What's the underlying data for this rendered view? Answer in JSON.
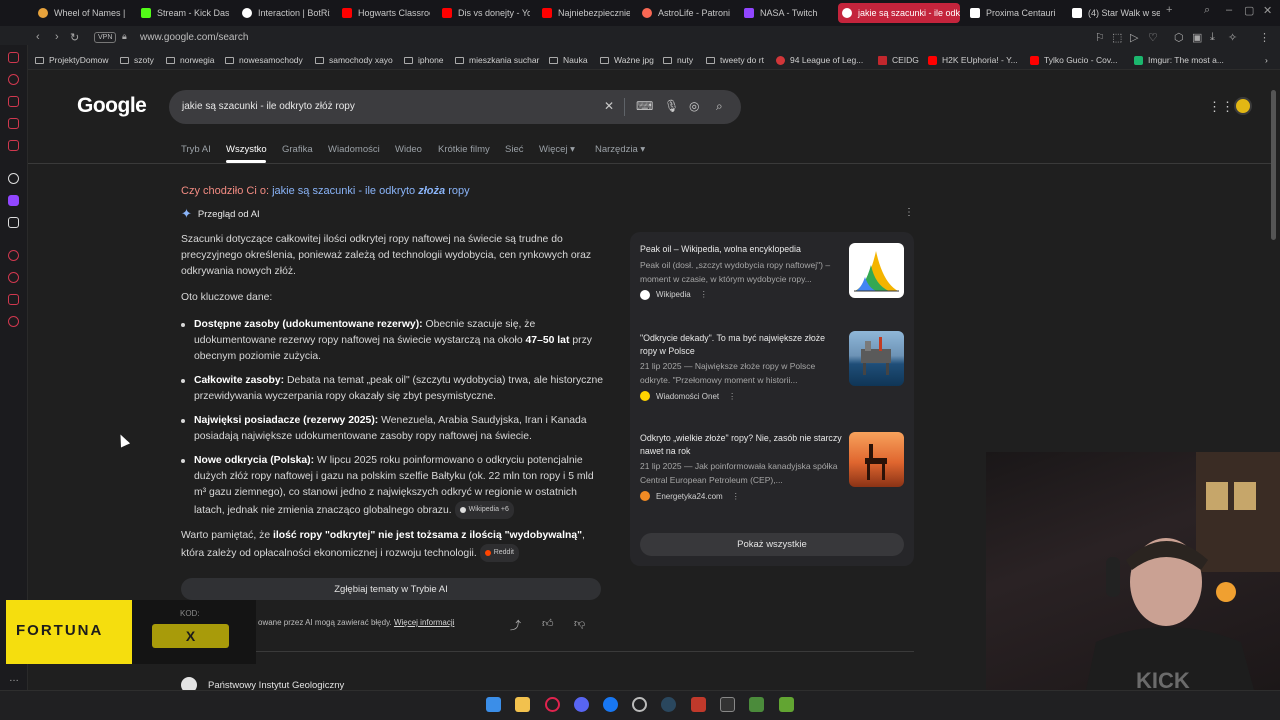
{
  "browser": {
    "tabs": [
      {
        "label": "Wheel of Names | F",
        "color": "#e8a33c"
      },
      {
        "label": "Stream - Kick Dash",
        "color": "#53fc18"
      },
      {
        "label": "Interaction | BotRix",
        "color": "#ffffff"
      },
      {
        "label": "Hogwarts Classroo",
        "color": "#ff0000"
      },
      {
        "label": "Dis vs donejty - Yo",
        "color": "#ff0000"
      },
      {
        "label": "Najniebezpieczniej",
        "color": "#ff0000"
      },
      {
        "label": "AstroLife - Patroni",
        "color": "#f96854"
      },
      {
        "label": "NASA - Twitch",
        "color": "#9146ff"
      },
      {
        "label": "jakie są szacunki - ile odk",
        "color": "#ffffff"
      },
      {
        "label": "Proxima Centauri b",
        "color": "#ffffff"
      },
      {
        "label": "(4) Star Walk w ser",
        "color": "#ffffff"
      }
    ],
    "vpn_label": "VPN",
    "url": "www.google.com/search",
    "bookmarks": [
      {
        "label": "ProjektyDomow",
        "type": "folder"
      },
      {
        "label": "szoty",
        "type": "folder"
      },
      {
        "label": "norwegia",
        "type": "folder"
      },
      {
        "label": "nowesamochody",
        "type": "folder"
      },
      {
        "label": "samochody xayo",
        "type": "folder"
      },
      {
        "label": "iphone",
        "type": "folder"
      },
      {
        "label": "mieszkania suchar",
        "type": "folder"
      },
      {
        "label": "Nauka",
        "type": "folder"
      },
      {
        "label": "Ważne jpg",
        "type": "folder"
      },
      {
        "label": "nuty",
        "type": "folder"
      },
      {
        "label": "tweety do rt",
        "type": "folder"
      },
      {
        "label": "94 League of Leg...",
        "type": "site",
        "color": "#d13639"
      },
      {
        "label": "CEIDG",
        "type": "site",
        "color": "#c2272d"
      },
      {
        "label": "H2K EUphoria! - Y...",
        "type": "site",
        "color": "#ff0000"
      },
      {
        "label": "Tylko Gucio - Cov...",
        "type": "site",
        "color": "#ff0000"
      },
      {
        "label": "Imgur: The most a...",
        "type": "site",
        "color": "#1bb76e"
      }
    ]
  },
  "google": {
    "logo": "Google",
    "query": "jakie są szacunki - ile odkryto złóż ropy",
    "tabs": [
      "Tryb AI",
      "Wszystko",
      "Grafika",
      "Wiadomości",
      "Wideo",
      "Krótkie filmy",
      "Sieć",
      "Więcej",
      "Narzędzia"
    ],
    "active_tab": "Wszystko",
    "did_you_mean_prefix": "Czy chodziło Ci o:",
    "did_you_mean_a": "jakie są szacunki - ile odkryto ",
    "did_you_mean_bold": "złoża",
    "did_you_mean_b": " ropy",
    "ai_header": "Przegląd od AI",
    "ai_intro": "Szacunki dotyczące całkowitej ilości odkrytej ropy naftowej na świecie są trudne do precyzyjnego określenia, ponieważ zależą od technologii wydobycia, cen rynkowych oraz odkrywania nowych złóż.",
    "ai_key_label": "Oto kluczowe dane:",
    "bullets": [
      {
        "bold": "Dostępne zasoby (udokumentowane rezerwy):",
        "text_a": " Obecnie szacuje się, że udokumentowane rezerwy ropy naftowej na świecie wystarczą na około ",
        "bold_b": "47–50 lat",
        "text_b": " przy obecnym poziomie zużycia."
      },
      {
        "bold": "Całkowite zasoby:",
        "text_a": " Debata na temat „peak oil\" (szczytu wydobycia) trwa, ale historyczne przewidywania wyczerpania ropy okazały się zbyt pesymistyczne.",
        "bold_b": "",
        "text_b": ""
      },
      {
        "bold": "Najwięksi posiadacze (rezerwy 2025):",
        "text_a": " Wenezuela, Arabia Saudyjska, Iran i Kanada posiadają największe udokumentowane zasoby ropy naftowej na świecie.",
        "bold_b": "",
        "text_b": ""
      },
      {
        "bold": "Nowe odkrycia (Polska):",
        "text_a": " W lipcu 2025 roku poinformowano o odkryciu potencjalnie dużych złóż ropy naftowej i gazu na polskim szelfie Bałtyku (ok. 22 mln ton ropy i 5 mld m³ gazu ziemnego), co stanowi jedno z największych odkryć w regionie w ostatnich latach, jednak nie zmienia znacząco globalnego obrazu.",
        "bold_b": "",
        "text_b": "",
        "chip": "Wikipedia +6"
      }
    ],
    "closing_a": "Warto pamiętać, że ",
    "closing_bold": "ilość ropy \"odkrytej\" nie jest tożsama z ilością \"wydobywalną\"",
    "closing_b": ", która zależy od opłacalności ekonomicznej i rozwoju technologii.",
    "closing_chip": "Reddit",
    "deep_button": "Zgłębiaj tematy w Trybie AI",
    "disclaimer": "owane przez AI mogą zawierać błędy.",
    "disclaimer_link": "Więcej informacji",
    "sources": [
      {
        "title": "Peak oil – Wikipedia, wolna encyklopedia",
        "desc": "Peak oil (dosł. „szczyt wydobycia ropy naftowej\") – moment w czasie, w którym wydobycie ropy...",
        "site": "Wikipedia",
        "color": "#ffffff"
      },
      {
        "title": "\"Odkrycie dekady\". To ma być największe złoże ropy w Polsce",
        "desc": "21 lip 2025 — Największe złoże ropy w Polsce odkryte. \"Przełomowy moment w historii...",
        "site": "Wiadomości Onet",
        "color": "#ffd400"
      },
      {
        "title": "Odkryto „wielkie złoże\" ropy? Nie, zasób nie starczy nawet na rok",
        "desc": "21 lip 2025 — Jak poinformowała kanadyjska spółka Central European Petroleum (CEP),...",
        "site": "Energetyka24.com",
        "color": "#f08a24"
      }
    ],
    "show_all": "Pokaż wszystkie",
    "next_result": "Państwowy Instytut Geologiczny"
  },
  "overlay": {
    "brand": "FORTUNA",
    "code_label": "KOD:",
    "code_value": "X"
  }
}
